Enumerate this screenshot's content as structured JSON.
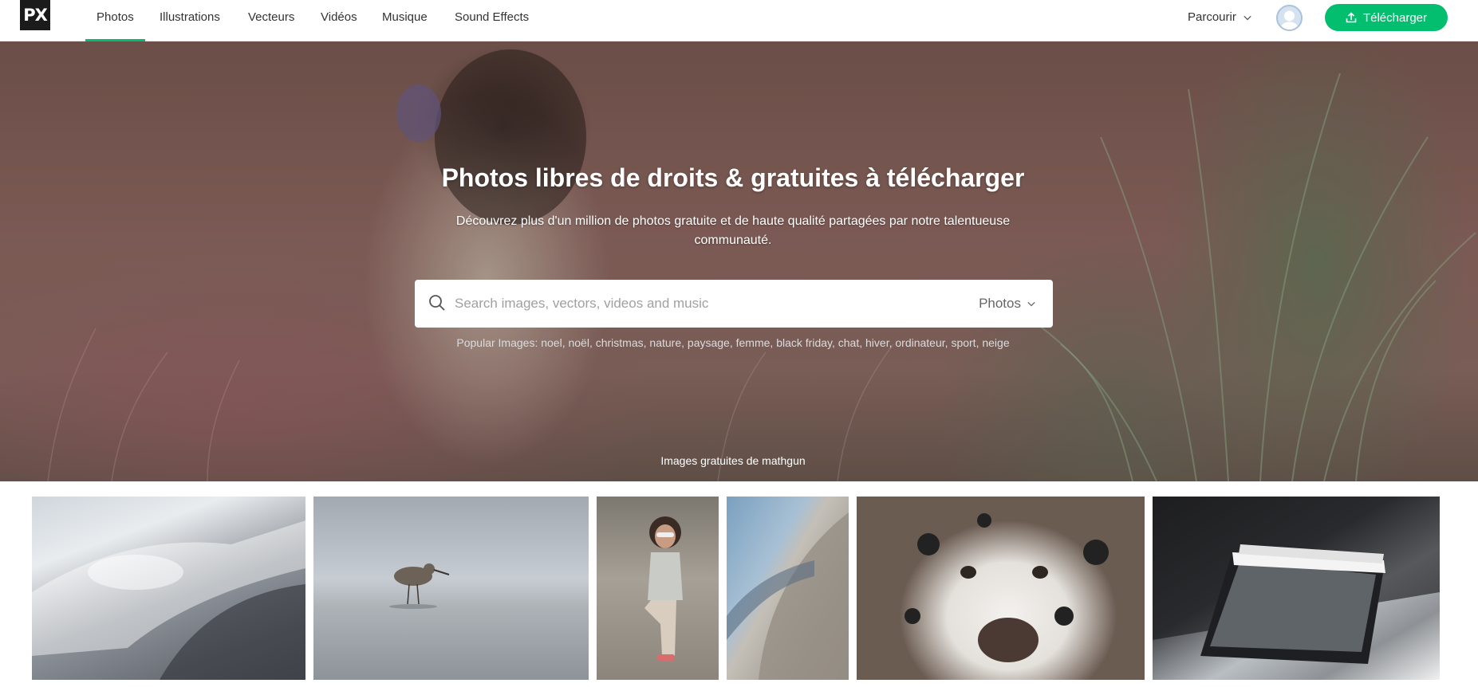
{
  "brand": {
    "logo_text": "PX"
  },
  "nav": {
    "items": [
      {
        "label": "Photos",
        "active": true
      },
      {
        "label": "Illustrations",
        "active": false
      },
      {
        "label": "Vecteurs",
        "active": false
      },
      {
        "label": "Vidéos",
        "active": false
      },
      {
        "label": "Musique",
        "active": false
      },
      {
        "label": "Sound Effects",
        "active": false
      }
    ],
    "browse_label": "Parcourir",
    "upload_label": "Télécharger"
  },
  "hero": {
    "title": "Photos libres de droits & gratuites à télécharger",
    "subtitle": "Découvrez plus d'un million de photos gratuite et de haute qualité partagées par notre talentueuse communauté.",
    "search": {
      "placeholder": "Search images, vectors, videos and music",
      "value": "",
      "type_selected": "Photos"
    },
    "popular": {
      "label": "Popular Images:",
      "tags": [
        "noel",
        "noël",
        "christmas",
        "nature",
        "paysage",
        "femme",
        "black friday",
        "chat",
        "hiver",
        "ordinateur",
        "sport",
        "neige"
      ]
    },
    "credit": "Images gratuites de mathgun"
  },
  "gallery": {
    "images": [
      {
        "subject": "modern-architecture"
      },
      {
        "subject": "bird-on-beach"
      },
      {
        "subject": "girl-with-sunglasses"
      },
      {
        "subject": "curved-building"
      },
      {
        "subject": "dalmatian-dog"
      },
      {
        "subject": "smartphone-on-laptop"
      }
    ]
  },
  "colors": {
    "accent": "#02be6e",
    "logo_bg": "#1b1b1b"
  },
  "icons": [
    "search-icon",
    "chevron-down-icon",
    "upload-icon",
    "user-avatar-icon"
  ]
}
